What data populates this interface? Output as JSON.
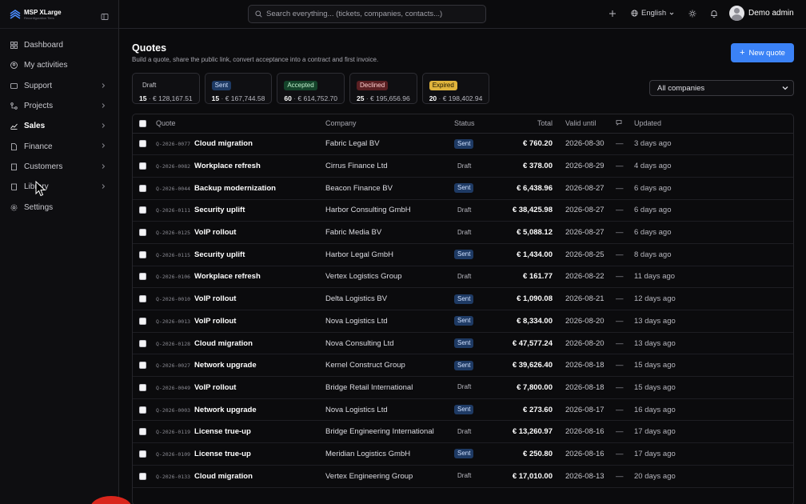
{
  "brand": {
    "name": "MSP XLarge",
    "sub": "Reconfiguration Tiers"
  },
  "nav": [
    {
      "label": "Dashboard",
      "icon": "dashboard-icon",
      "chevron": false
    },
    {
      "label": "My activities",
      "icon": "user-circle-icon",
      "chevron": false
    },
    {
      "label": "Support",
      "icon": "support-icon",
      "chevron": true
    },
    {
      "label": "Projects",
      "icon": "projects-icon",
      "chevron": true
    },
    {
      "label": "Sales",
      "icon": "chart-line-icon",
      "chevron": true,
      "active": true
    },
    {
      "label": "Finance",
      "icon": "document-icon",
      "chevron": true
    },
    {
      "label": "Customers",
      "icon": "building-icon",
      "chevron": true
    },
    {
      "label": "Library",
      "icon": "book-icon",
      "chevron": true
    },
    {
      "label": "Settings",
      "icon": "gear-icon",
      "chevron": false
    }
  ],
  "topbar": {
    "search_placeholder": "Search everything... (tickets, companies, contacts...)",
    "language": "English",
    "user": "Demo admin"
  },
  "page": {
    "title": "Quotes",
    "subtitle": "Build a quote, share the public link, convert acceptance into a contract and first invoice.",
    "new_button": "New quote"
  },
  "stats": [
    {
      "label": "Draft",
      "count": "15",
      "amount": "€ 128,167.51",
      "kind": "draft"
    },
    {
      "label": "Sent",
      "count": "15",
      "amount": "€ 167,744.58",
      "kind": "sent"
    },
    {
      "label": "Accepted",
      "count": "60",
      "amount": "€ 614,752.70",
      "kind": "accepted"
    },
    {
      "label": "Declined",
      "count": "25",
      "amount": "€ 195,656.96",
      "kind": "declined"
    },
    {
      "label": "Expired",
      "count": "20",
      "amount": "€ 198,402.94",
      "kind": "expired"
    }
  ],
  "filter": {
    "selected": "All companies"
  },
  "table": {
    "headers": {
      "quote": "Quote",
      "company": "Company",
      "status": "Status",
      "total": "Total",
      "valid": "Valid until",
      "updated": "Updated"
    },
    "rows": [
      {
        "num": "Q-2026-0077",
        "name": "Cloud migration",
        "company": "Fabric Legal BV",
        "status": "Sent",
        "total": "€ 760.20",
        "valid": "2026-08-30",
        "cmt": "—",
        "updated": "3 days ago"
      },
      {
        "num": "Q-2026-0082",
        "name": "Workplace refresh",
        "company": "Cirrus Finance Ltd",
        "status": "Draft",
        "total": "€ 378.00",
        "valid": "2026-08-29",
        "cmt": "—",
        "updated": "4 days ago"
      },
      {
        "num": "Q-2026-0044",
        "name": "Backup modernization",
        "company": "Beacon Finance BV",
        "status": "Sent",
        "total": "€ 6,438.96",
        "valid": "2026-08-27",
        "cmt": "—",
        "updated": "6 days ago"
      },
      {
        "num": "Q-2026-0111",
        "name": "Security uplift",
        "company": "Harbor Consulting GmbH",
        "status": "Draft",
        "total": "€ 38,425.98",
        "valid": "2026-08-27",
        "cmt": "—",
        "updated": "6 days ago"
      },
      {
        "num": "Q-2026-0125",
        "name": "VoIP rollout",
        "company": "Fabric Media BV",
        "status": "Draft",
        "total": "€ 5,088.12",
        "valid": "2026-08-27",
        "cmt": "—",
        "updated": "6 days ago"
      },
      {
        "num": "Q-2026-0115",
        "name": "Security uplift",
        "company": "Harbor Legal GmbH",
        "status": "Sent",
        "total": "€ 1,434.00",
        "valid": "2026-08-25",
        "cmt": "—",
        "updated": "8 days ago"
      },
      {
        "num": "Q-2026-0106",
        "name": "Workplace refresh",
        "company": "Vertex Logistics Group",
        "status": "Draft",
        "total": "€ 161.77",
        "valid": "2026-08-22",
        "cmt": "—",
        "updated": "11 days ago"
      },
      {
        "num": "Q-2026-0010",
        "name": "VoIP rollout",
        "company": "Delta Logistics BV",
        "status": "Sent",
        "total": "€ 1,090.08",
        "valid": "2026-08-21",
        "cmt": "—",
        "updated": "12 days ago"
      },
      {
        "num": "Q-2026-0013",
        "name": "VoIP rollout",
        "company": "Nova Logistics Ltd",
        "status": "Sent",
        "total": "€ 8,334.00",
        "valid": "2026-08-20",
        "cmt": "—",
        "updated": "13 days ago"
      },
      {
        "num": "Q-2026-0128",
        "name": "Cloud migration",
        "company": "Nova Consulting Ltd",
        "status": "Sent",
        "total": "€ 47,577.24",
        "valid": "2026-08-20",
        "cmt": "—",
        "updated": "13 days ago"
      },
      {
        "num": "Q-2026-0027",
        "name": "Network upgrade",
        "company": "Kernel Construct Group",
        "status": "Sent",
        "total": "€ 39,626.40",
        "valid": "2026-08-18",
        "cmt": "—",
        "updated": "15 days ago"
      },
      {
        "num": "Q-2026-0049",
        "name": "VoIP rollout",
        "company": "Bridge Retail International",
        "status": "Draft",
        "total": "€ 7,800.00",
        "valid": "2026-08-18",
        "cmt": "—",
        "updated": "15 days ago"
      },
      {
        "num": "Q-2026-0003",
        "name": "Network upgrade",
        "company": "Nova Logistics Ltd",
        "status": "Sent",
        "total": "€ 273.60",
        "valid": "2026-08-17",
        "cmt": "—",
        "updated": "16 days ago"
      },
      {
        "num": "Q-2026-0119",
        "name": "License true-up",
        "company": "Bridge Engineering International",
        "status": "Draft",
        "total": "€ 13,260.97",
        "valid": "2026-08-16",
        "cmt": "—",
        "updated": "17 days ago"
      },
      {
        "num": "Q-2026-0109",
        "name": "License true-up",
        "company": "Meridian Logistics GmbH",
        "status": "Sent",
        "total": "€ 250.80",
        "valid": "2026-08-16",
        "cmt": "—",
        "updated": "17 days ago"
      },
      {
        "num": "Q-2026-0133",
        "name": "Cloud migration",
        "company": "Vertex Engineering Group",
        "status": "Draft",
        "total": "€ 17,010.00",
        "valid": "2026-08-13",
        "cmt": "—",
        "updated": "20 days ago"
      }
    ]
  },
  "colors": {
    "accent": "#3b82f6",
    "background": "#0b0b0d"
  }
}
